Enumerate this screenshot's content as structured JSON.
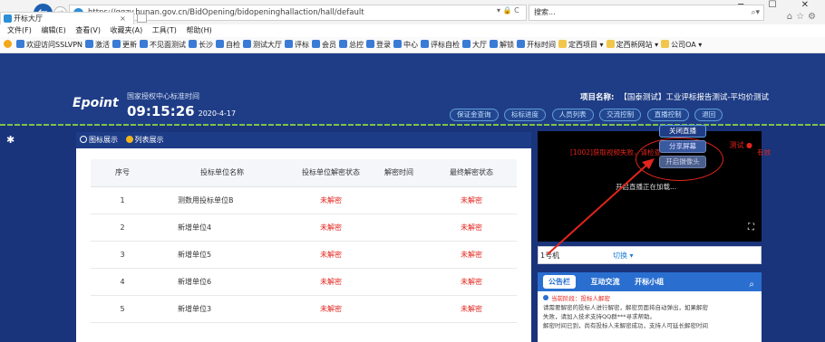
{
  "browser": {
    "url": "https://ggzy.hunan.gov.cn/BidOpening/bidopeninghallaction/hall/default",
    "addr_tools": "▾ 🔒 C",
    "search_text": "搜索...",
    "tab_title": "开标大厅",
    "tab_close": "×",
    "win_controls": "─ ☐ ✕",
    "top_icons": "⌂☆⚙",
    "menu": [
      "文件(F)",
      "编辑(E)",
      "查看(V)",
      "收藏夹(A)",
      "工具(T)",
      "帮助(H)"
    ],
    "favorites": [
      {
        "label": "欢迎访问SSLVPN",
        "kind": "page"
      },
      {
        "label": "激活",
        "kind": "page"
      },
      {
        "label": "更新",
        "kind": "page"
      },
      {
        "label": "不见面测试",
        "kind": "page"
      },
      {
        "label": "长沙",
        "kind": "page"
      },
      {
        "label": "自检",
        "kind": "page"
      },
      {
        "label": "测试大厅",
        "kind": "page"
      },
      {
        "label": "评标",
        "kind": "page"
      },
      {
        "label": "会员",
        "kind": "page"
      },
      {
        "label": "总控",
        "kind": "page"
      },
      {
        "label": "登录",
        "kind": "page"
      },
      {
        "label": "中心",
        "kind": "page"
      },
      {
        "label": "评标自检",
        "kind": "page"
      },
      {
        "label": "大厅",
        "kind": "page"
      },
      {
        "label": "解锁",
        "kind": "page"
      },
      {
        "label": "开标时间",
        "kind": "page"
      },
      {
        "label": "定西项目 ▾",
        "kind": "folder"
      },
      {
        "label": "定西新网站 ▾",
        "kind": "folder"
      },
      {
        "label": "公司OA ▾",
        "kind": "folder"
      }
    ]
  },
  "header": {
    "logo": "Epoint",
    "center_name": "国家授权中心标准时间",
    "time": "09:15:26",
    "date": "2020-4-17",
    "project_label": "项目名称:",
    "project_name": "【国泰测试】工业评标报告测试-平均价测试",
    "buttons": [
      "保证金查询",
      "标标进度",
      "人员列表",
      "交流控制",
      "直播控制",
      "退回"
    ]
  },
  "bid_panel": {
    "options": [
      "图标展示",
      "列表展示"
    ],
    "columns": [
      "序号",
      "投标单位名称",
      "投标单位解密状态",
      "解密时间",
      "最终解密状态"
    ],
    "rows": [
      {
        "no": "1",
        "name": "测数用投标单位B",
        "status": "未解密",
        "time": "",
        "final": "未解密"
      },
      {
        "no": "2",
        "name": "新增单位4",
        "status": "未解密",
        "time": "",
        "final": "未解密"
      },
      {
        "no": "3",
        "name": "新增单位5",
        "status": "未解密",
        "time": "",
        "final": "未解密"
      },
      {
        "no": "4",
        "name": "新增单位6",
        "status": "未解密",
        "time": "",
        "final": "未解密"
      },
      {
        "no": "5",
        "name": "新增单位3",
        "status": "未解密",
        "time": "",
        "final": "未解密"
      }
    ]
  },
  "video": {
    "error": "[1002]获取视频失败，请检查",
    "error_tail": "有效",
    "loading": "开启直播正在加载...",
    "badge": "测试 ●",
    "fullscreen_icon": "⛶"
  },
  "live_menu": [
    "关闭直播",
    "分享屏幕",
    "开启摄像头"
  ],
  "switch_row": {
    "device": "1号机",
    "switch_label": "切换 ▾"
  },
  "notice": {
    "tabs": [
      "公告栏",
      "互动交流",
      "开标小组"
    ],
    "search_icon": "⌕",
    "heading": "当前阶段：投标人解密",
    "line1": "请需要解密的投标人进行解密，解密页面将自动弹出，如果解密",
    "line2": "失败，请加入技术支持QQ群***寻求帮助。",
    "line3": "解密时间已到，尚有投标人未解密成功，支持人可延长解密时间"
  },
  "colors": {
    "header_bg": "#1f3d86",
    "danger": "#e2251d",
    "accent": "#2a6fd0"
  }
}
